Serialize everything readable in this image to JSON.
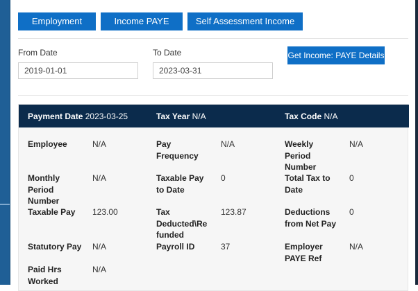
{
  "tabs": [
    {
      "label": "Employment details"
    },
    {
      "label": "Income PAYE details"
    },
    {
      "label": "Self Assessment Income details"
    }
  ],
  "filters": {
    "from_label": "From Date",
    "from_value": "2019-01-01",
    "to_label": "To Date",
    "to_value": "2023-03-31",
    "submit_label": "Get Income: PAYE Details"
  },
  "record": {
    "header": {
      "payment_date_label": "Payment Date",
      "payment_date_value": "2023-03-25",
      "tax_year_label": "Tax Year",
      "tax_year_value": "N/A",
      "tax_code_label": "Tax Code",
      "tax_code_value": "N/A"
    },
    "rows": [
      [
        {
          "label": "Employee",
          "value": "N/A"
        },
        {
          "label": "Pay\nFrequency",
          "value": "N/A"
        },
        {
          "label": "Weekly\nPeriod\nNumber",
          "value": "N/A"
        }
      ],
      [
        {
          "label": "Monthly\nPeriod\nNumber",
          "value": "N/A"
        },
        {
          "label": "Taxable Pay\nto Date",
          "value": "0"
        },
        {
          "label": "Total Tax to\nDate",
          "value": "0"
        }
      ],
      [
        {
          "label": "Taxable Pay",
          "value": "123.00"
        },
        {
          "label": "Tax\nDeducted\\Re\nfunded",
          "value": "123.87"
        },
        {
          "label": "Deductions\nfrom Net Pay",
          "value": "0"
        }
      ],
      [
        {
          "label": "Statutory Pay",
          "value": "N/A"
        },
        {
          "label": "Payroll ID",
          "value": "37"
        },
        {
          "label": "Employer\nPAYE Ref",
          "value": "N/A"
        }
      ],
      [
        {
          "label": "Paid Hrs\nWorked",
          "value": "N/A"
        }
      ]
    ]
  }
}
